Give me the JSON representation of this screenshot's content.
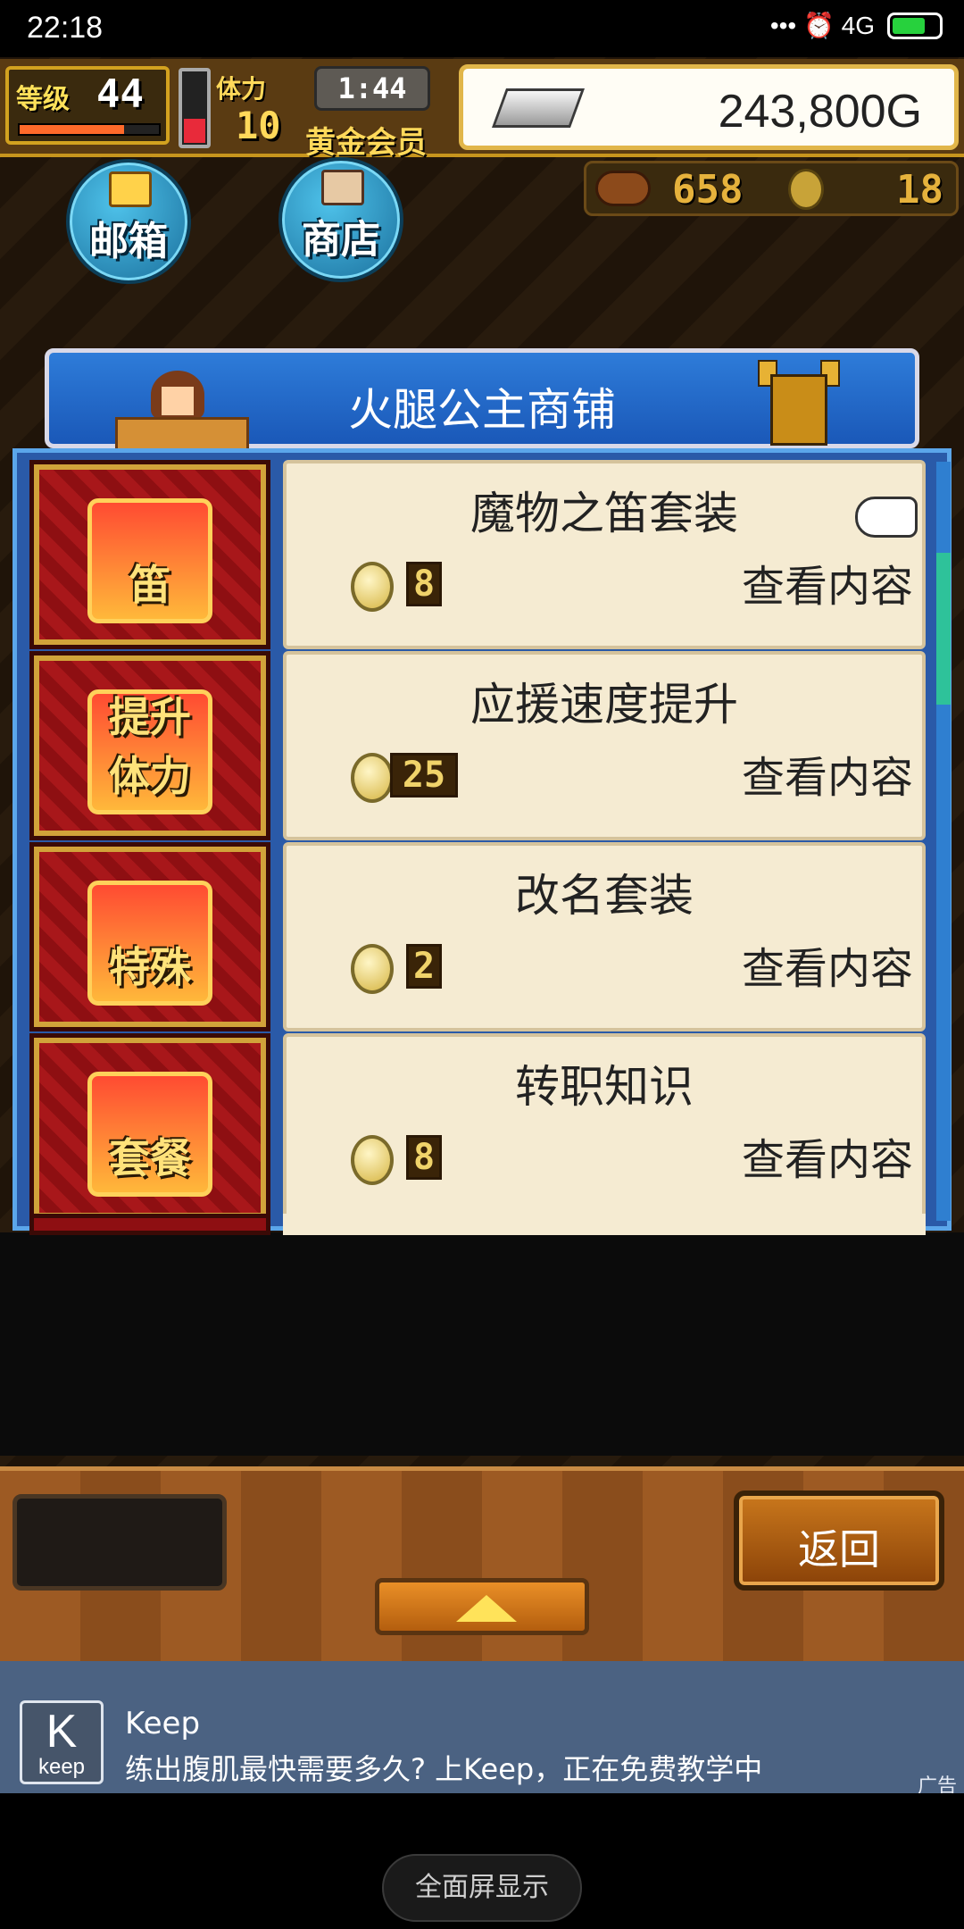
{
  "status_bar": {
    "time": "22:18",
    "indicators": "••• ⏰ 4G",
    "battery_level": 0.7
  },
  "hud": {
    "level_label": "等级",
    "level_value": "44",
    "level_progress": 0.75,
    "stamina_label": "体力",
    "stamina_value": "10",
    "stamina_gauge_level": 0.35,
    "timer": "1:44",
    "member_label": "黄金会员",
    "gold": "243,800G",
    "meat_count": "658",
    "coin_count": "18"
  },
  "buttons": {
    "mail": "邮箱",
    "shop": "商店"
  },
  "shop": {
    "title": "火腿公主商铺",
    "scroll_position": 0.15,
    "items": [
      {
        "name": "魔物之笛套装",
        "icon_word": "笛",
        "icon": "flute-icon",
        "price": "8",
        "view": "查看内容"
      },
      {
        "name": "应援速度提升",
        "icon_word": "提升体力",
        "icon": "arrow-up-icon",
        "price": "25",
        "view": "查看内容"
      },
      {
        "name": "改名套装",
        "icon_word": "特殊",
        "icon": "treasure-chest-icon",
        "price": "2",
        "view": "查看内容"
      },
      {
        "name": "转职知识",
        "icon_word": "套餐",
        "icon": "lightbulb-icon",
        "price": "8",
        "view": "查看内容"
      }
    ]
  },
  "bottom_bar": {
    "back_label": "返回"
  },
  "ad": {
    "app_name": "Keep",
    "logo_letter": "K",
    "logo_word": "keep",
    "description": "练出腹肌最快需要多久? 上Keep，正在免费教学中",
    "tag": "广告"
  },
  "system": {
    "fullscreen_label": "全面屏显示"
  },
  "colors": {
    "panel_blue": "#2e7cd9",
    "card_cream": "#f5ebd2",
    "tile_red": "#a8171a",
    "ad_bg": "#4b6282"
  }
}
